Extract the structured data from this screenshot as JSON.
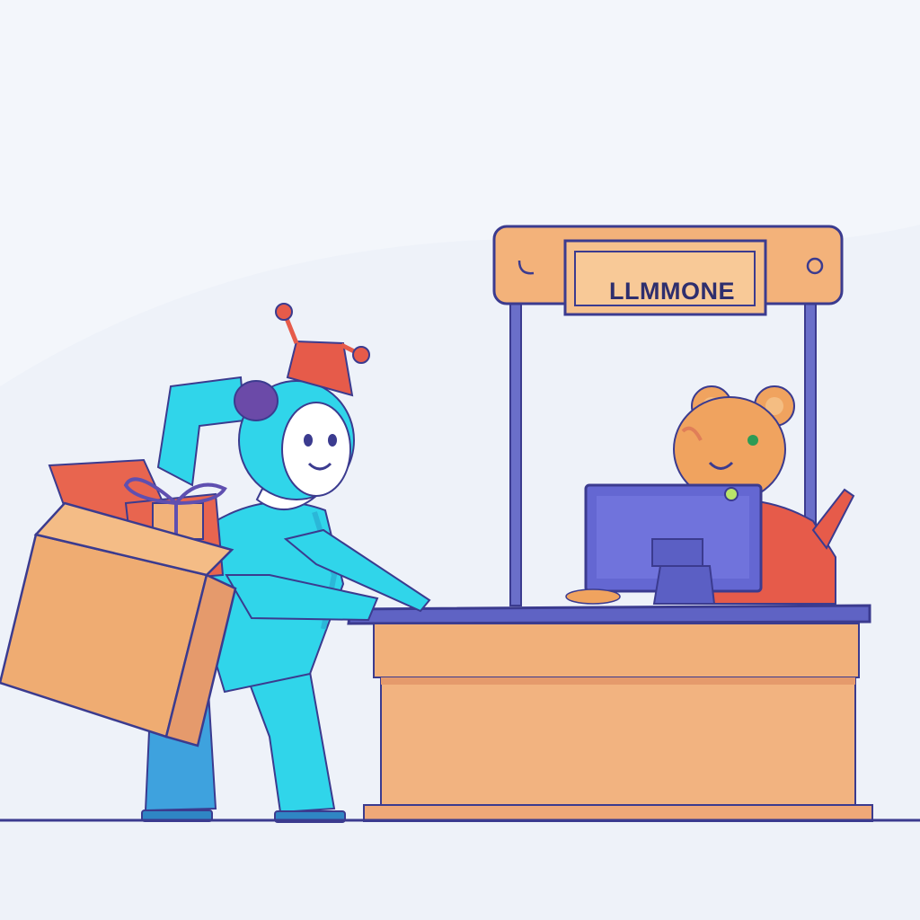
{
  "sign": {
    "text": "LLMMONE"
  },
  "palette": {
    "background": "#f3f6fb",
    "ink": "#3b3b8f",
    "desk_top": "#5f63c4",
    "wood": "#f1b07a",
    "wood_shade": "#e59a6c",
    "robot_cyan": "#30d5ea",
    "robot_blue": "#3ea2de",
    "hat_red": "#e65b4a",
    "bear_orange": "#f0a35f",
    "monitor": "#6467d2",
    "box": "#efac72",
    "gift_red": "#e8654f"
  },
  "icons": {
    "monitor": "computer-monitor-icon",
    "sign": "shop-sign-icon",
    "gift": "gift-box-icon"
  }
}
